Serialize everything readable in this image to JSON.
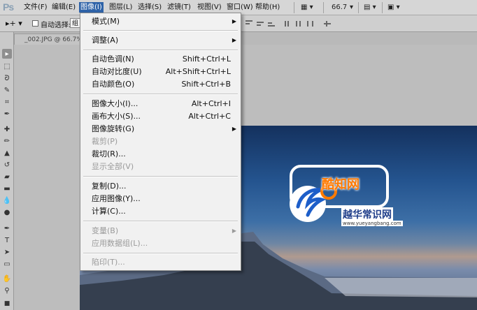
{
  "menubar": {
    "logo": "Ps",
    "items": [
      "文件(F)",
      "编辑(E)",
      "图像(I)",
      "图层(L)",
      "选择(S)",
      "滤镜(T)",
      "视图(V)",
      "窗口(W)",
      "帮助(H)"
    ],
    "zoom": "66.7"
  },
  "options": {
    "auto_select_label": "自动选择:",
    "group_value": "组"
  },
  "document": {
    "tab_title": "_002.JPG @ 66.7%",
    "watermark_text": "酷知网",
    "watermark_title": "越华常识网",
    "watermark_url": "www.yueyangbang.com"
  },
  "image_menu": {
    "items": [
      {
        "label": "模式(M)",
        "shortcut": "",
        "submenu": true,
        "disabled": false
      },
      {
        "label": "调整(A)",
        "shortcut": "",
        "submenu": true,
        "disabled": false
      },
      {
        "label": "自动色调(N)",
        "shortcut": "Shift+Ctrl+L",
        "submenu": false,
        "disabled": false
      },
      {
        "label": "自动对比度(U)",
        "shortcut": "Alt+Shift+Ctrl+L",
        "submenu": false,
        "disabled": false
      },
      {
        "label": "自动颜色(O)",
        "shortcut": "Shift+Ctrl+B",
        "submenu": false,
        "disabled": false
      },
      {
        "label": "图像大小(I)...",
        "shortcut": "Alt+Ctrl+I",
        "submenu": false,
        "disabled": false
      },
      {
        "label": "画布大小(S)...",
        "shortcut": "Alt+Ctrl+C",
        "submenu": false,
        "disabled": false
      },
      {
        "label": "图像旋转(G)",
        "shortcut": "",
        "submenu": true,
        "disabled": false
      },
      {
        "label": "裁剪(P)",
        "shortcut": "",
        "submenu": false,
        "disabled": true
      },
      {
        "label": "裁切(R)...",
        "shortcut": "",
        "submenu": false,
        "disabled": false
      },
      {
        "label": "显示全部(V)",
        "shortcut": "",
        "submenu": false,
        "disabled": true
      },
      {
        "label": "复制(D)...",
        "shortcut": "",
        "submenu": false,
        "disabled": false
      },
      {
        "label": "应用图像(Y)...",
        "shortcut": "",
        "submenu": false,
        "disabled": false
      },
      {
        "label": "计算(C)...",
        "shortcut": "",
        "submenu": false,
        "disabled": false
      },
      {
        "label": "变量(B)",
        "shortcut": "",
        "submenu": true,
        "disabled": true
      },
      {
        "label": "应用数据组(L)...",
        "shortcut": "",
        "submenu": false,
        "disabled": true
      },
      {
        "label": "陷印(T)...",
        "shortcut": "",
        "submenu": false,
        "disabled": true
      }
    ]
  },
  "tools": [
    "move-tool-icon",
    "marquee-tool-icon",
    "lasso-tool-icon",
    "quick-select-tool-icon",
    "crop-tool-icon",
    "eyedropper-tool-icon",
    "healing-brush-icon",
    "brush-tool-icon",
    "clone-stamp-icon",
    "history-brush-icon",
    "eraser-tool-icon",
    "gradient-tool-icon",
    "blur-tool-icon",
    "dodge-tool-icon",
    "pen-tool-icon",
    "type-tool-icon",
    "path-select-icon",
    "shape-tool-icon",
    "hand-tool-icon",
    "zoom-tool-icon"
  ],
  "colors": {
    "menu_highlight": "#2f63a8",
    "menu_bg": "#f1f1f1",
    "disabled_text": "#9a9a9a"
  }
}
